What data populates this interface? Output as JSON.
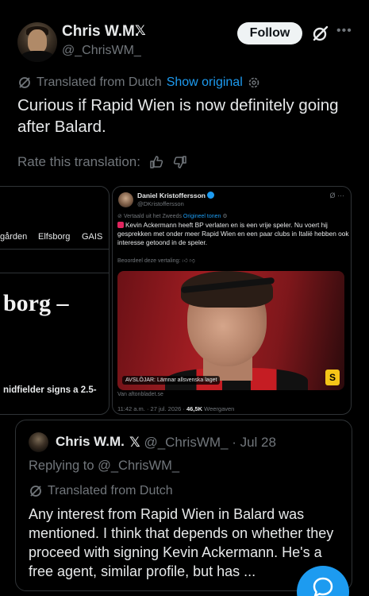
{
  "top_cut_text": "",
  "author": {
    "name": "Chris W.M.",
    "handle": "@_ChrisWM_",
    "x_glyph": "𝕏"
  },
  "follow_label": "Follow",
  "more_glyph": "•••",
  "translation": {
    "label": "Translated from Dutch",
    "show_original": "Show original"
  },
  "tweet_text": "Curious if Rapid Wien is now definitely going after Balard.",
  "rate_label": "Rate this translation:",
  "left_card": {
    "tabs": [
      "gården",
      "Elfsborg",
      "GAIS"
    ],
    "headline": "borg –",
    "subline": "nidfielder signs a 2.5-"
  },
  "right_card": {
    "name": "Daniel Kristoffersson",
    "handle": "@DKristoffersson",
    "translated_label": "Vertaald uit het Zweeds",
    "original_link": "Origineel tonen",
    "text": "Kevin Ackermann heeft BP verlaten en is een vrije speler. Nu voert hij gesprekken met onder meer Rapid Wien en een paar clubs in Italië hebben ook interesse getoond in de speler.",
    "rate_label": "Beoordeel deze vertaling:",
    "photo_caption": "AVSLÖJAR: Lämnar allsvenska laget",
    "badge": "S",
    "source": "Van aftonbladet.se",
    "time": "11:42 a.m. · 27 jul. 2026 ·",
    "views_count": "46,5K",
    "views_label": "Weergaven"
  },
  "reply": {
    "name": "Chris W.M.",
    "x_glyph": "𝕏",
    "handle_date": "@_ChrisWM_ · Jul 28",
    "replying_to": "Replying to @_ChrisWM_",
    "translated_label": "Translated from Dutch",
    "text": "Any interest from Rapid Wien in Balard was mentioned. I think that depends on whether they proceed with signing Kevin Ackermann. He's a free agent, similar profile, but has ..."
  },
  "colors": {
    "background": "#000000",
    "text": "#e7e9ea",
    "muted": "#71767b",
    "accent": "#1d9bf0",
    "border": "#2f3336"
  },
  "icons": [
    "grok-icon",
    "translate-icon",
    "gear-icon",
    "thumbs-up-icon",
    "thumbs-down-icon",
    "compose-reply-icon"
  ]
}
